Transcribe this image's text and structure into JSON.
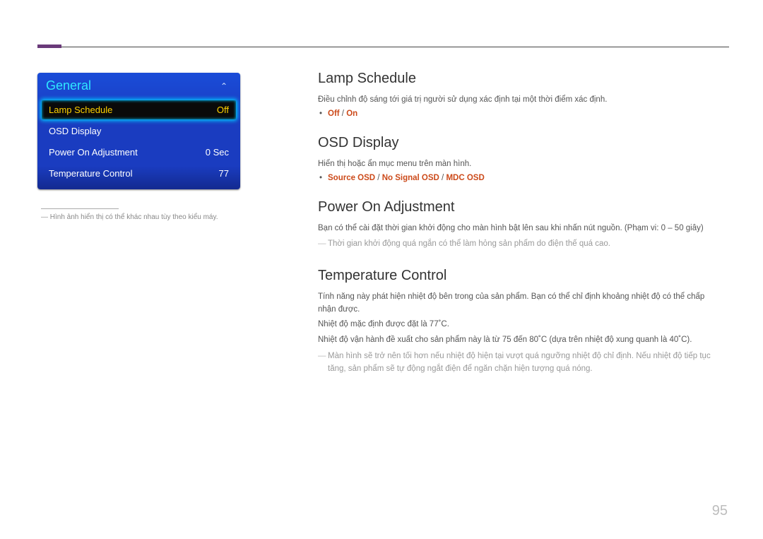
{
  "page_number": "95",
  "osd": {
    "title": "General",
    "arrow": "⌃",
    "rows": [
      {
        "label": "Lamp Schedule",
        "value": "Off",
        "selected": true
      },
      {
        "label": "OSD Display",
        "value": "",
        "selected": false
      },
      {
        "label": "Power On Adjustment",
        "value": "0 Sec",
        "selected": false
      },
      {
        "label": "Temperature Control",
        "value": "77",
        "selected": false
      }
    ],
    "footnote": "Hình ảnh hiển thị có thể khác nhau tùy theo kiểu máy."
  },
  "sections": {
    "lamp": {
      "heading": "Lamp Schedule",
      "desc": "Điều chỉnh độ sáng tới giá trị người sử dụng xác định tại một thời điểm xác định.",
      "opt1": "Off",
      "sep": " / ",
      "opt2": "On"
    },
    "osd_display": {
      "heading": "OSD Display",
      "desc": "Hiển thị hoặc ẩn mục menu trên màn hình.",
      "opt1": "Source OSD",
      "sep1": " / ",
      "opt2": "No Signal OSD",
      "sep2": " / ",
      "opt3": "MDC OSD"
    },
    "power_on": {
      "heading": "Power On Adjustment",
      "desc": "Bạn có thể cài đặt thời gian khởi động cho màn hình bật lên sau khi nhấn nút nguồn. (Phạm vi: 0 – 50 giây)",
      "note": "Thời gian khởi động quá ngắn có thể làm hỏng sản phẩm do điện thế quá cao."
    },
    "temp": {
      "heading": "Temperature Control",
      "p1": "Tính năng này phát hiện nhiệt độ bên trong của sản phẩm. Bạn có thể chỉ định khoảng nhiệt độ có thể chấp nhận được.",
      "p2": "Nhiệt độ mặc định được đặt là 77˚C.",
      "p3": "Nhiệt độ vận hành đề xuất cho sản phẩm này là từ 75 đến 80˚C (dựa trên nhiệt độ xung quanh là 40˚C).",
      "note": "Màn hình sẽ trở nên tối hơn nếu nhiệt độ hiện tại vượt quá ngưỡng nhiệt độ chỉ định. Nếu nhiệt độ tiếp tục tăng, sản phẩm sẽ tự động ngắt điện để ngăn chặn hiện tượng quá nóng."
    }
  }
}
